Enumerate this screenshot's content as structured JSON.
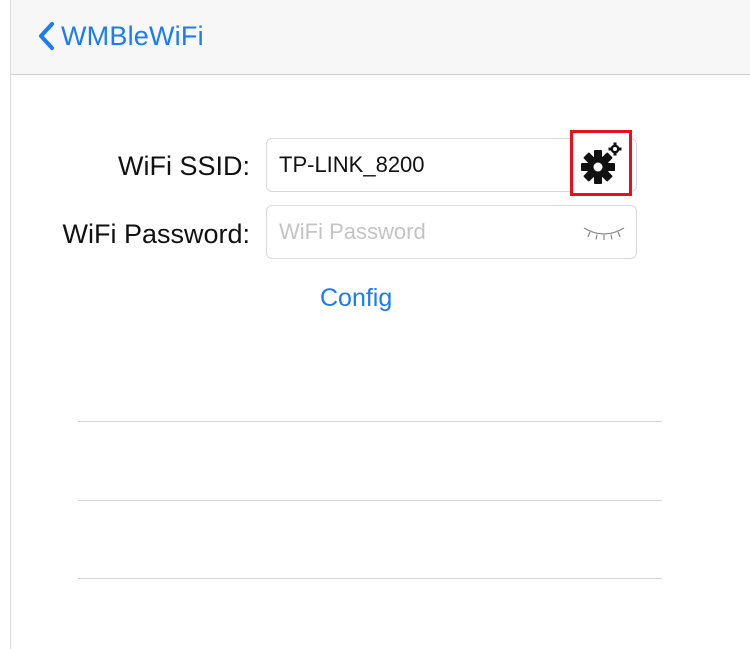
{
  "navbar": {
    "back_label": "WMBleWiFi",
    "back_icon": "chevron-left-icon",
    "accent_color": "#1a7cf5"
  },
  "form": {
    "ssid_label": "WiFi SSID:",
    "ssid_value": "TP-LINK_8200",
    "settings_icon": "gear-icon",
    "password_label": "WiFi Password:",
    "password_placeholder": "WiFi Password",
    "password_value": "",
    "visibility_icon": "eye-closed-icon",
    "config_label": "Config"
  },
  "highlight_color": "#e8101a"
}
